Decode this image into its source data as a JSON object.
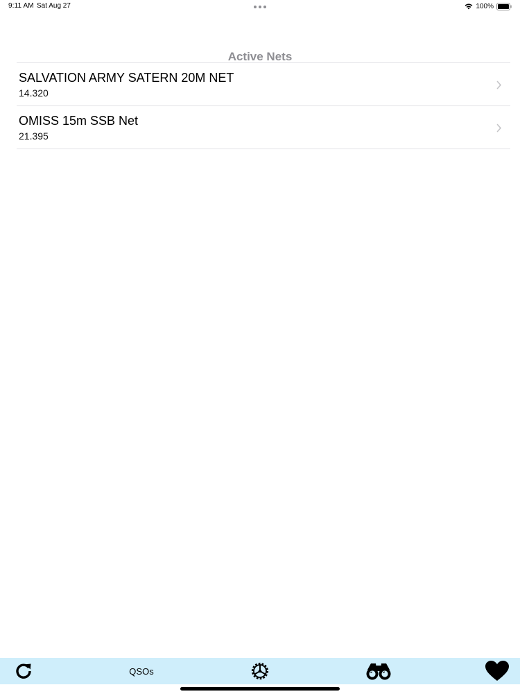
{
  "status_bar": {
    "time": "9:11 AM",
    "date": "Sat Aug 27",
    "battery": "100%",
    "icons": [
      "wifi-icon",
      "battery-icon",
      "multitasking-dots-icon"
    ]
  },
  "section": {
    "title": "Active Nets"
  },
  "nets": [
    {
      "name": "SALVATION ARMY SATERN 20M NET",
      "frequency": "14.320"
    },
    {
      "name": "OMISS 15m SSB Net",
      "frequency": "21.395"
    }
  ],
  "tab_bar": {
    "qsos_label": "QSOs",
    "icons": [
      "refresh-icon",
      "gear-icon",
      "binoculars-icon",
      "heart-icon"
    ]
  },
  "colors": {
    "tab_bar_bg": "#cfeefb",
    "header_gray": "#8e8e93",
    "separator": "#e2e2e6"
  }
}
